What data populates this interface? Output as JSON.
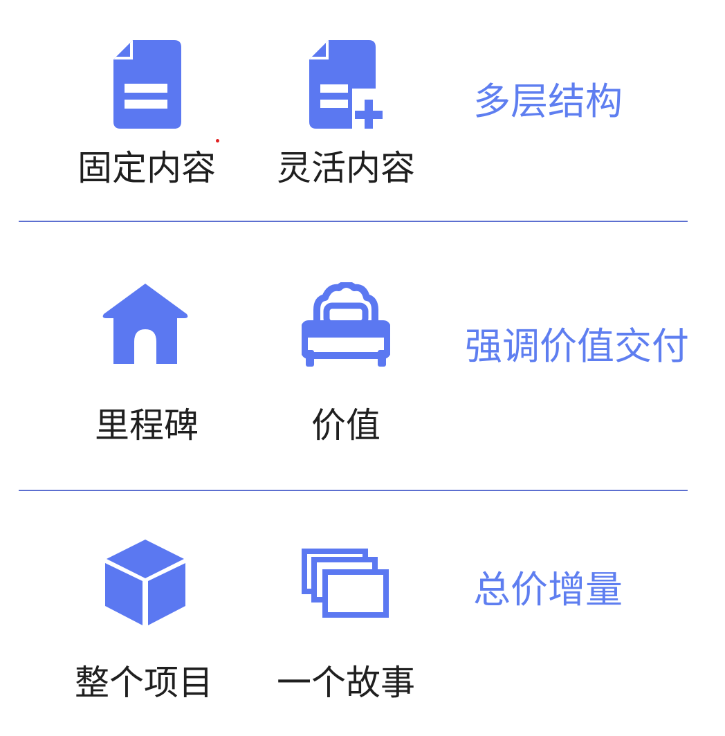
{
  "colors": {
    "accent": "#5b78f1",
    "title": "#5e7ef0",
    "divider": "#5c6fd0",
    "text": "#1f1f1f"
  },
  "rows": [
    {
      "title": "多层结构",
      "items": [
        {
          "label": "固定内容",
          "icon": "document-icon"
        },
        {
          "label": "灵活内容",
          "icon": "document-add-icon"
        }
      ]
    },
    {
      "title": "强调价值交付",
      "items": [
        {
          "label": "里程碑",
          "icon": "house-icon"
        },
        {
          "label": "价值",
          "icon": "bed-icon"
        }
      ]
    },
    {
      "title": "总价增量",
      "items": [
        {
          "label": "整个项目",
          "icon": "cube-icon"
        },
        {
          "label": "一个故事",
          "icon": "stacked-cards-icon"
        }
      ]
    }
  ]
}
